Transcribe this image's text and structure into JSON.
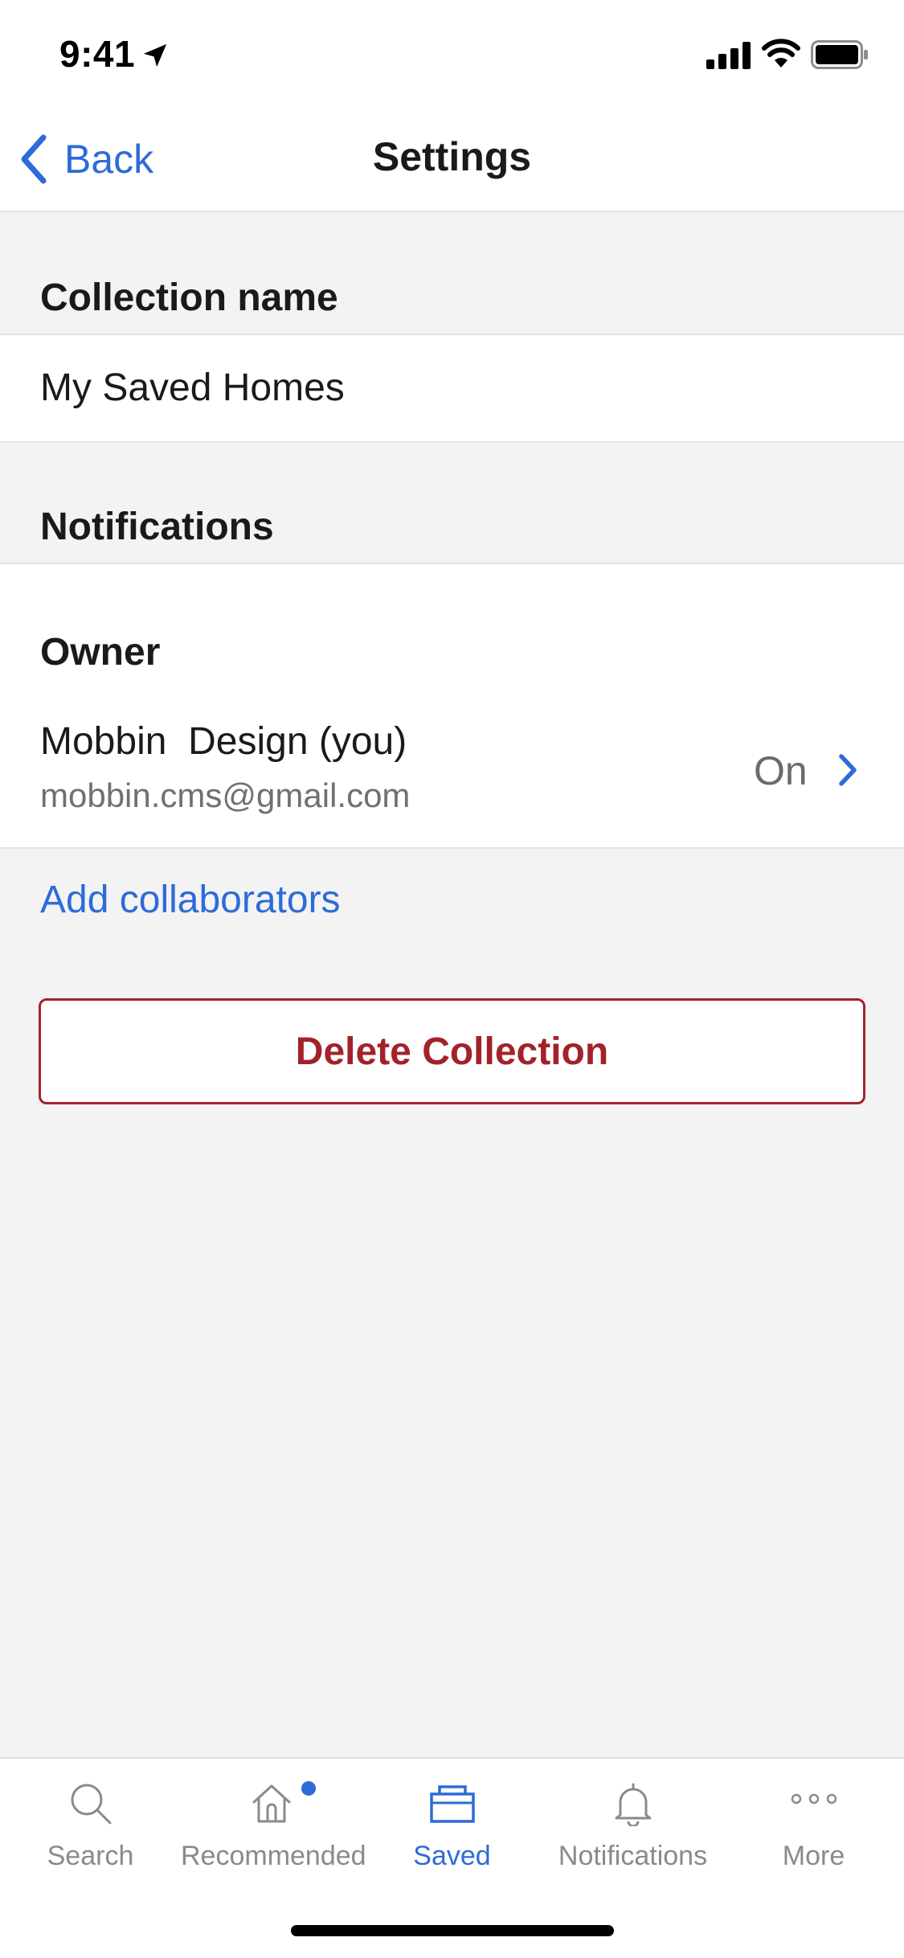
{
  "status_bar": {
    "time": "9:41"
  },
  "nav": {
    "back_label": "Back",
    "title": "Settings"
  },
  "collection": {
    "header": "Collection name",
    "value": "My Saved Homes"
  },
  "notifications": {
    "header": "Notifications",
    "owner_label": "Owner",
    "owner_name": "Mobbin  Design (you)",
    "owner_email": "mobbin.cms@gmail.com",
    "owner_status": "On"
  },
  "actions": {
    "add_collaborators": "Add collaborators",
    "delete_collection": "Delete Collection"
  },
  "tab_bar": {
    "items": [
      {
        "label": "Search",
        "icon": "search-icon",
        "active": false
      },
      {
        "label": "Recommended",
        "icon": "home-icon",
        "active": false,
        "badge": true
      },
      {
        "label": "Saved",
        "icon": "folder-icon",
        "active": true
      },
      {
        "label": "Notifications",
        "icon": "bell-icon",
        "active": false
      },
      {
        "label": "More",
        "icon": "more-icon",
        "active": false
      }
    ]
  },
  "colors": {
    "accent": "#2d6bd8",
    "danger": "#a3222a",
    "background": "#f3f3f3"
  }
}
